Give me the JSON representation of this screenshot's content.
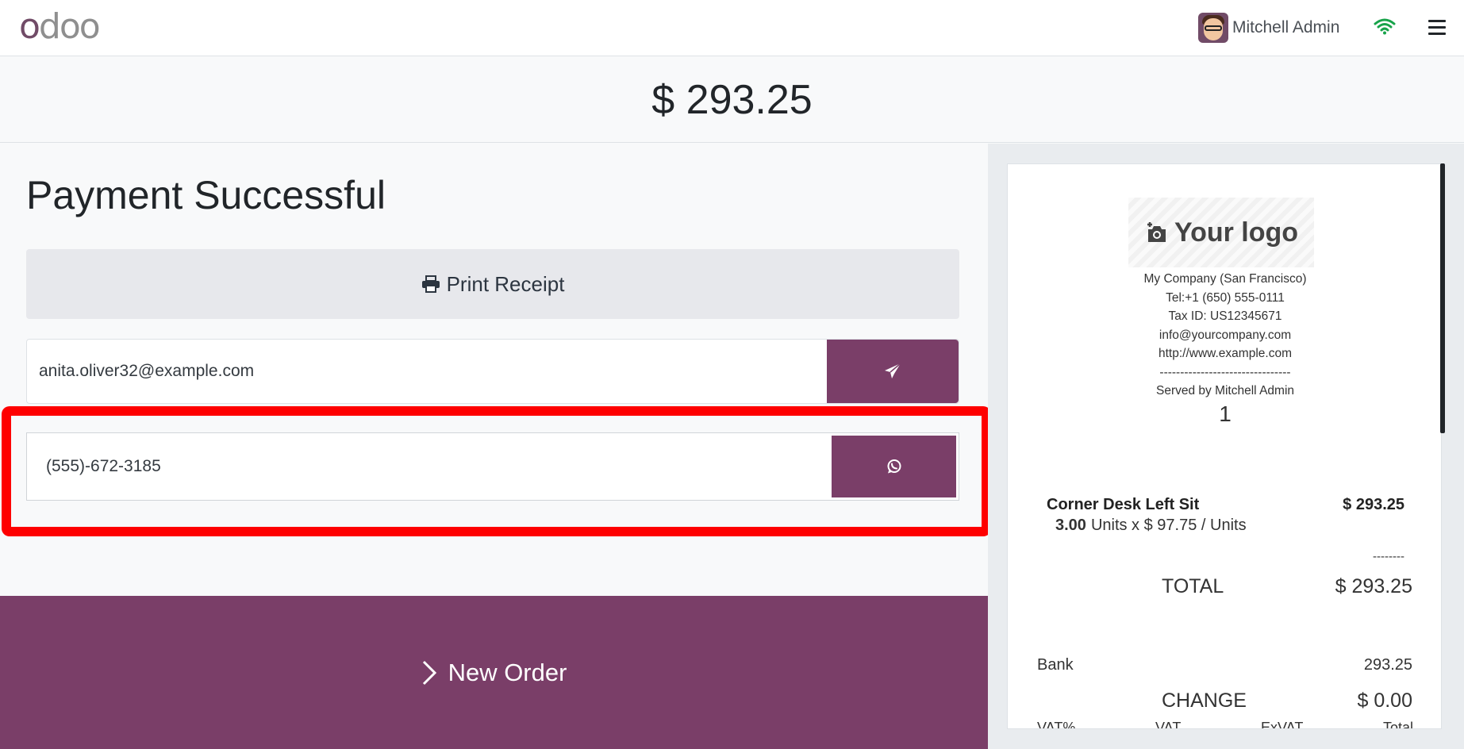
{
  "header": {
    "logo_first": "o",
    "logo_rest": "doo",
    "user_name": "Mitchell Admin",
    "wifi_icon": "wifi-icon",
    "menu_icon": "hamburger-menu-icon",
    "wifi_color": "#18a34a"
  },
  "amount": "$ 293.25",
  "payment": {
    "title": "Payment Successful",
    "print_label": "Print Receipt",
    "email_value": "anita.oliver32@example.com",
    "phone_value": "(555)-672-3185",
    "new_order_label": "New Order"
  },
  "receipt": {
    "logo_text": "Your logo",
    "company_lines": [
      "My Company (San Francisco)",
      "Tel:+1 (650) 555-0111",
      "Tax ID: US12345671",
      "info@yourcompany.com",
      "http://www.example.com",
      "--------------------------------",
      "Served by Mitchell Admin"
    ],
    "order_number": "1",
    "line": {
      "name": "Corner Desk Left Sit",
      "price": "$ 293.25",
      "qty": "3.00",
      "qty_detail": "Units x $ 97.75 / Units"
    },
    "dashes": "--------",
    "total_label": "TOTAL",
    "total_value": "$ 293.25",
    "bank_label": "Bank",
    "bank_value": "293.25",
    "change_label": "CHANGE",
    "change_value": "$ 0.00",
    "vat_headers": [
      "VAT%",
      "VAT",
      "ExVAT",
      "Total"
    ]
  },
  "colors": {
    "brand": "#7a3e68",
    "highlight": "#fe0000"
  }
}
